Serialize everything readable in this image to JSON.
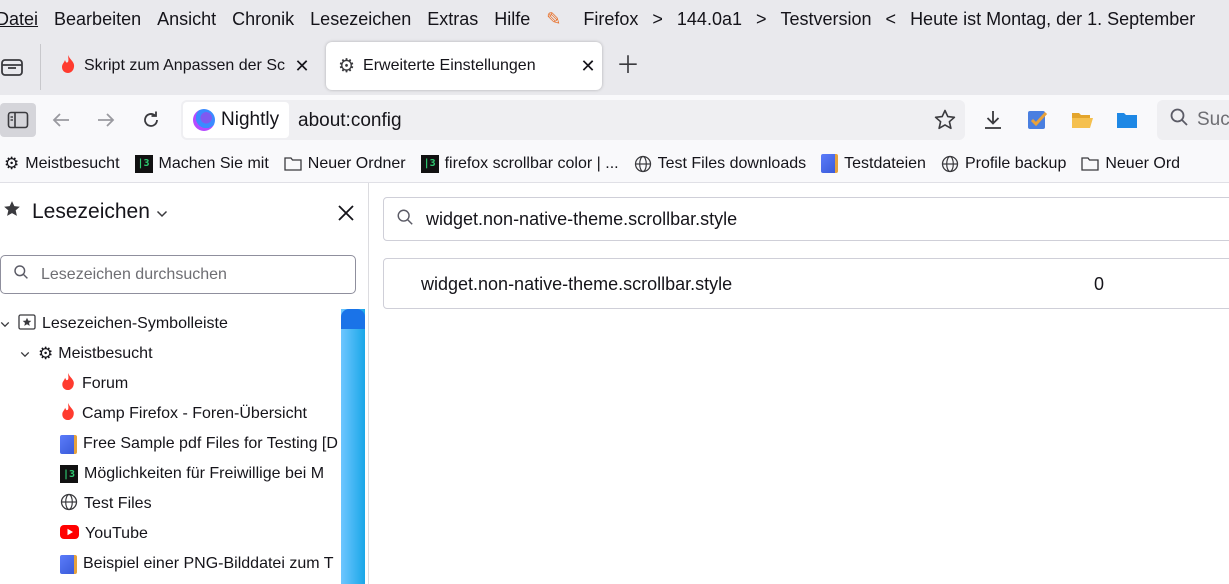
{
  "menubar": {
    "items": [
      "Datei",
      "Bearbeiten",
      "Ansicht",
      "Chronik",
      "Lesezeichen",
      "Extras",
      "Hilfe"
    ],
    "info": [
      "Firefox",
      ">",
      "144.0a1",
      ">",
      "Testversion",
      "<",
      "Heute ist Montag, der 1. September"
    ]
  },
  "tabs": [
    {
      "title": "Skript zum Anpassen der Sc",
      "icon": "fire-icon"
    },
    {
      "title": "Erweiterte Einstellungen",
      "icon": "gear-icon"
    }
  ],
  "navbar": {
    "identity_label": "Nightly",
    "url": "about:config",
    "search_placeholder": "Such"
  },
  "bookmarks_bar": [
    {
      "label": "Meistbesucht",
      "icon": "gear-icon"
    },
    {
      "label": "Machen Sie mit",
      "icon": "github-icon"
    },
    {
      "label": "Neuer Ordner",
      "icon": "folder-icon"
    },
    {
      "label": "firefox scrollbar color | ...",
      "icon": "github-icon"
    },
    {
      "label": "Test Files downloads",
      "icon": "globe-icon"
    },
    {
      "label": "Testdateien",
      "icon": "book-icon"
    },
    {
      "label": "Profile backup",
      "icon": "globe-icon"
    },
    {
      "label": "Neuer Ord",
      "icon": "folder-icon"
    }
  ],
  "sidebar": {
    "title": "Lesezeichen",
    "search_placeholder": "Lesezeichen durchsuchen",
    "tree": [
      {
        "label": "Lesezeichen-Symbolleiste",
        "icon": "bookmark-toolbar-icon",
        "level": 0,
        "expanded": true
      },
      {
        "label": "Meistbesucht",
        "icon": "gear-icon",
        "level": 1,
        "expanded": true
      },
      {
        "label": "Forum",
        "icon": "fire-icon",
        "level": 2
      },
      {
        "label": "Camp Firefox - Foren-Übersicht",
        "icon": "fire-icon",
        "level": 2
      },
      {
        "label": "Free Sample pdf Files for Testing [D",
        "icon": "book-icon",
        "level": 2
      },
      {
        "label": "Möglichkeiten für Freiwillige bei M",
        "icon": "github-icon",
        "level": 2
      },
      {
        "label": "Test Files",
        "icon": "globe-icon",
        "level": 2
      },
      {
        "label": "YouTube",
        "icon": "youtube-icon",
        "level": 2
      },
      {
        "label": "Beispiel einer PNG-Bilddatei zum T",
        "icon": "book-icon",
        "level": 2
      }
    ]
  },
  "config": {
    "search_value": "widget.non-native-theme.scrollbar.style",
    "rows": [
      {
        "name": "widget.non-native-theme.scrollbar.style",
        "value": "0"
      }
    ]
  },
  "colors": {
    "chrome_bg": "#e9e9ed",
    "toolbar_bg": "#f9f9fb",
    "scroll_thumb": "#1a73e8",
    "fire": "#ff3b2f"
  }
}
